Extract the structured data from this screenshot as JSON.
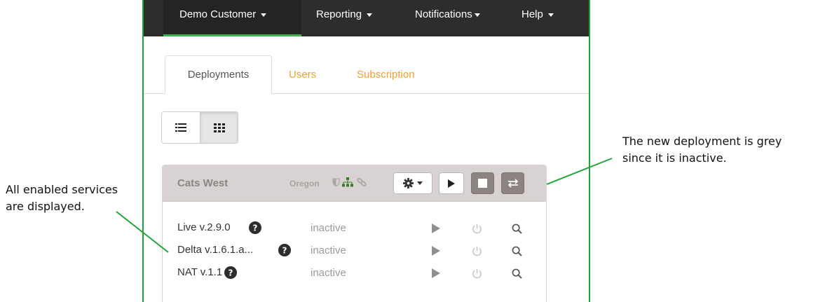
{
  "nav": {
    "items": [
      {
        "label": "Demo Customer",
        "active": true
      },
      {
        "label": "Reporting",
        "active": false
      },
      {
        "label": "Notifications",
        "active": false
      },
      {
        "label": "Help",
        "active": false
      }
    ]
  },
  "tabs": [
    {
      "label": "Deployments",
      "active": true
    },
    {
      "label": "Users",
      "active": false
    },
    {
      "label": "Subscription",
      "active": false
    }
  ],
  "view_toggle": {
    "options": [
      {
        "icon": "list-view-icon",
        "selected": false
      },
      {
        "icon": "grid-view-icon",
        "selected": true
      }
    ]
  },
  "deployment": {
    "name": "Cats West",
    "region": "Oregon",
    "state_icons": [
      "shield-icon",
      "sitemap-icon",
      "link-icon"
    ],
    "actions": [
      "gear-dropdown",
      "play-icon",
      "stop-icon",
      "swap-icon"
    ],
    "services": [
      {
        "name": "Live v.2.9.0",
        "status": "inactive"
      },
      {
        "name": "Delta v.1.6.1.a...",
        "status": "inactive"
      },
      {
        "name": "NAT v.1.1",
        "status": "inactive"
      }
    ]
  },
  "annotations": {
    "left_line1": "All enabled services",
    "left_line2": "are displayed.",
    "right_line1": "The new deployment is grey",
    "right_line2": "since it is inactive."
  },
  "colors": {
    "frame_border": "#22a33a",
    "nav_bg": "#2f2d2c",
    "nav_active_underline": "#3fb34f",
    "tab_link": "#f0a030",
    "panel_header": "#d8d3d2",
    "inactive_text": "#9b9b9b",
    "callout_line": "#22a33a"
  }
}
